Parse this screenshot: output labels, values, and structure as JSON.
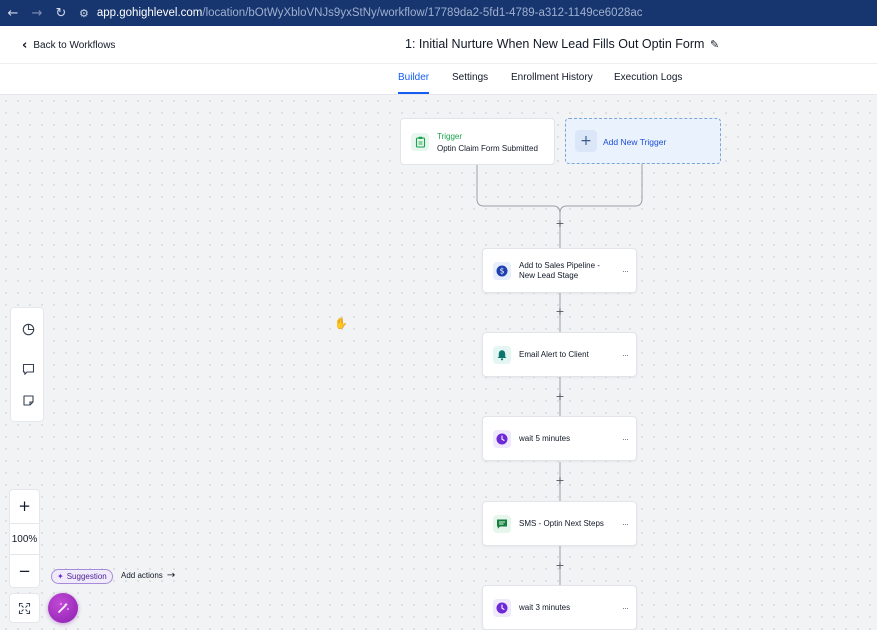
{
  "browser": {
    "url_host": "app.gohighlevel.com",
    "url_path": "/location/bOtWyXbloVNJs9yxStNy/workflow/17789da2-5fd1-4789-a312-1149ce6028ac",
    "back_icon": "arrow-left",
    "forward_icon": "arrow-right",
    "reload_icon": "reload"
  },
  "header": {
    "back_label": "Back to Workflows",
    "title": "1: Initial Nurture When New Lead Fills Out Optin Form"
  },
  "tabs": [
    {
      "label": "Builder",
      "active": true
    },
    {
      "label": "Settings",
      "active": false
    },
    {
      "label": "Enrollment History",
      "active": false
    },
    {
      "label": "Execution Logs",
      "active": false
    }
  ],
  "trigger": {
    "type_label": "Trigger",
    "name": "Optin Claim Form Submitted"
  },
  "add_trigger": {
    "label": "Add New Trigger"
  },
  "actions": [
    {
      "line1": "Add to Sales Pipeline -",
      "line2": "New Lead Stage",
      "icon": "dollar-icon",
      "color": "#1e40af",
      "bg": "#e7eefc"
    },
    {
      "line1": "Email Alert to Client",
      "line2": "",
      "icon": "bell-icon",
      "color": "#0f766e",
      "bg": "#e4f6f1"
    },
    {
      "line1": "wait 5 minutes",
      "line2": "",
      "icon": "clock-icon",
      "color": "#6d28d9",
      "bg": "#efe9fb"
    },
    {
      "line1": "SMS - Optin Next Steps",
      "line2": "",
      "icon": "chat-icon",
      "color": "#15803d",
      "bg": "#e6f6ec"
    },
    {
      "line1": "wait 3 minutes",
      "line2": "",
      "icon": "clock-icon",
      "color": "#6d28d9",
      "bg": "#efe9fb"
    }
  ],
  "zoom": {
    "level": "100%",
    "plus": "+",
    "minus": "−"
  },
  "suggestion": {
    "badge": "Suggestion",
    "action": "Add actions"
  },
  "colors": {
    "accent": "#155eef",
    "browser_bar": "#17356e",
    "trigger_green": "#16a34a"
  }
}
